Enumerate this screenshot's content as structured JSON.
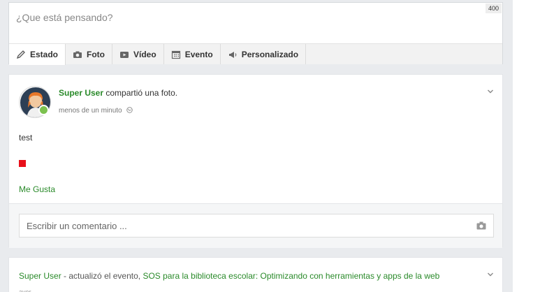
{
  "composer": {
    "placeholder": "¿Que está pensando?",
    "char_count": "400",
    "tabs": [
      {
        "label": "Estado",
        "icon": "pencil-icon"
      },
      {
        "label": "Foto",
        "icon": "camera-icon"
      },
      {
        "label": "Vídeo",
        "icon": "play-icon"
      },
      {
        "label": "Evento",
        "icon": "calendar-icon"
      },
      {
        "label": "Personalizado",
        "icon": "megaphone-icon"
      }
    ]
  },
  "post": {
    "user": "Super User",
    "action": "compartió una foto.",
    "time": "menos de un minuto",
    "text": "test",
    "like_label": "Me Gusta",
    "comment_placeholder": "Escribir un comentario ..."
  },
  "post2": {
    "user": "Super User",
    "separator": " - actualizó el evento, ",
    "event_title": "SOS para la biblioteca escolar: Optimizando con herramientas y apps de la web",
    "sub": "ayer"
  },
  "colors": {
    "accent": "#2a8a2a",
    "image": "#e8101a",
    "online": "#7cc14f"
  }
}
